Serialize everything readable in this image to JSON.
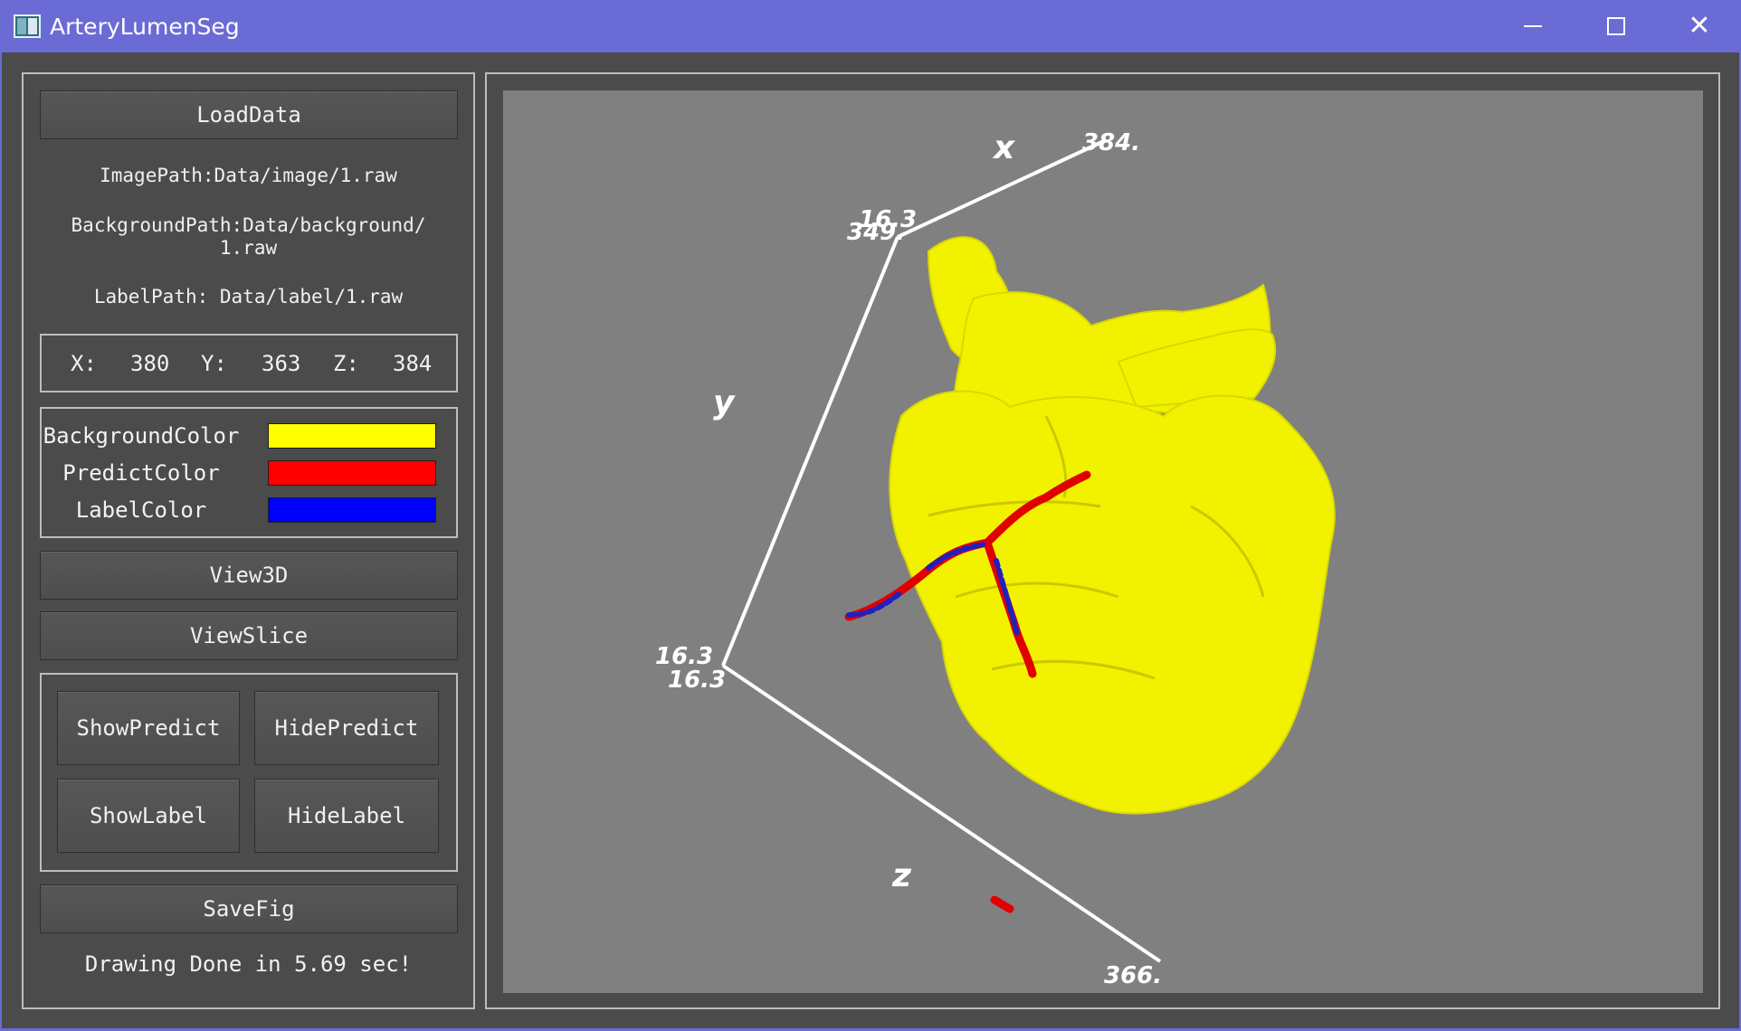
{
  "window": {
    "title": "ArteryLumenSeg",
    "minimize_icon": "minimize-icon",
    "maximize_icon": "maximize-icon",
    "close_glyph": "✕"
  },
  "panel": {
    "load_button": "LoadData",
    "image_path": "ImagePath:Data/image/1.raw",
    "background_path_line1": "BackgroundPath:Data/background/",
    "background_path_line2": "1.raw",
    "label_path": "LabelPath: Data/label/1.raw",
    "coords": {
      "x_label": "X:",
      "x_value": "380",
      "y_label": "Y:",
      "y_value": "363",
      "z_label": "Z:",
      "z_value": "384"
    },
    "colors": [
      {
        "label": "BackgroundColor",
        "hex": "#ffff00"
      },
      {
        "label": "PredictColor",
        "hex": "#ff0000"
      },
      {
        "label": "LabelColor",
        "hex": "#0000ff"
      }
    ],
    "view3d_button": "View3D",
    "viewslice_button": "ViewSlice",
    "show_predict": "ShowPredict",
    "hide_predict": "HidePredict",
    "show_label": "ShowLabel",
    "hide_label": "HideLabel",
    "savefig_button": "SaveFig",
    "status": "Drawing Done in 5.69 sec!"
  },
  "viewer": {
    "axes": {
      "x_name": "x",
      "y_name": "y",
      "z_name": "z",
      "x_max": "384.",
      "y_top_a": "16.3",
      "y_top_b": "349.",
      "origin_a": "16.3",
      "origin_b": "16.3",
      "z_max": "366."
    },
    "mesh_color": "#f2f200",
    "predict_color": "#e00000",
    "label_color": "#2020c0"
  }
}
